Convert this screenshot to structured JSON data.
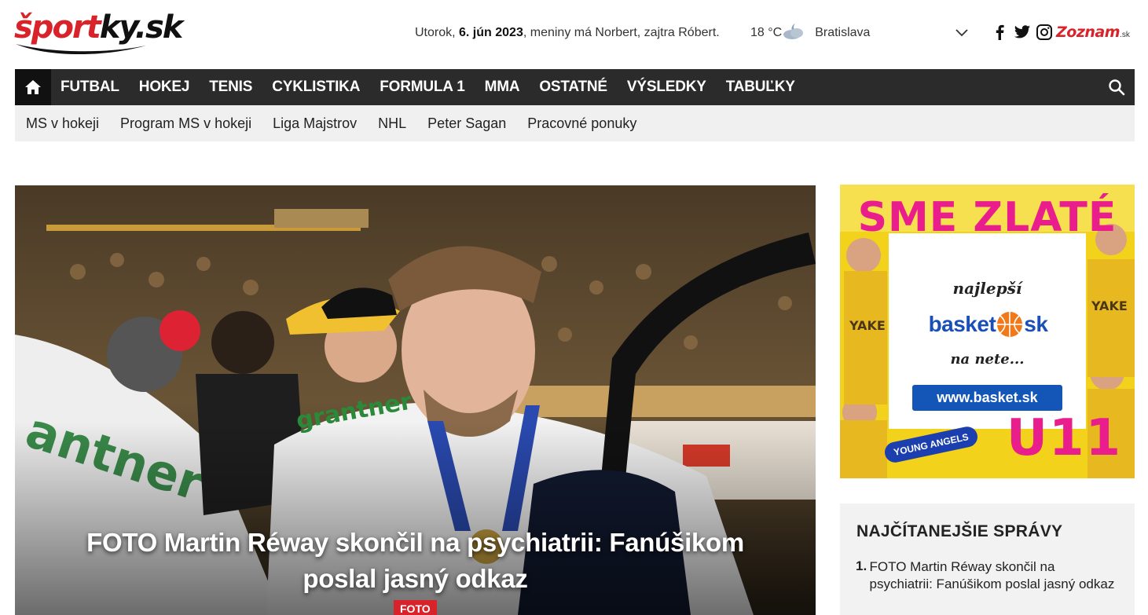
{
  "header": {
    "logo_text_red": "šport",
    "logo_text_black": "ky",
    "logo_text_suffix": ".sk",
    "date_prefix": "Utorok, ",
    "date_bold": "6. jún 2023",
    "date_suffix": ", meniny má Norbert, zajtra Róbert.",
    "weather_temp": "18 °C",
    "weather_icon": "partly-cloudy-night-icon",
    "weather_city": "Bratislava",
    "social_icons": [
      "facebook-icon",
      "twitter-icon",
      "instagram-icon"
    ],
    "partner_logo": "Zoznam",
    "partner_logo_suffix": ".sk"
  },
  "nav": {
    "home_icon": "home-icon",
    "items": [
      {
        "label": "FUTBAL"
      },
      {
        "label": "HOKEJ"
      },
      {
        "label": "TENIS"
      },
      {
        "label": "CYKLISTIKA"
      },
      {
        "label": "FORMULA 1"
      },
      {
        "label": "MMA"
      },
      {
        "label": "OSTATNÉ"
      },
      {
        "label": "VÝSLEDKY"
      },
      {
        "label": "TABUĽKY"
      }
    ],
    "search_icon": "search-icon"
  },
  "subnav": {
    "items": [
      {
        "label": "MS v hokeji"
      },
      {
        "label": "Program MS v hokeji"
      },
      {
        "label": "Liga Majstrov"
      },
      {
        "label": "NHL"
      },
      {
        "label": "Peter Sagan"
      },
      {
        "label": "Pracovné ponuky"
      }
    ]
  },
  "hero": {
    "title": "FOTO Martin Réway skončil na psychiatrii: Fanúšikom poslal jasný odkaz",
    "badge": "FOTO",
    "jersey_text": "grantner"
  },
  "ad": {
    "headline": "SME ZLATÉ",
    "najlepsi": "najlepší",
    "logo_left": "basket",
    "logo_right": "sk",
    "na_nete": "na nete...",
    "url": "www.basket.sk",
    "team_badge": "YOUNG ANGELS",
    "category": "U11",
    "colors": {
      "pink": "#e91e8c",
      "blue": "#1456b8",
      "yellow": "#f2d21a"
    }
  },
  "most_read": {
    "title": "NAJČÍTANEJŠIE SPRÁVY",
    "items": [
      {
        "num": "1.",
        "text": "FOTO Martin Réway skončil na psychiatrii: Fanúšikom poslal jasný odkaz"
      }
    ]
  },
  "colors": {
    "brand_red": "#d8232a",
    "nav_bg": "#2b2b2b",
    "subnav_bg": "#f0f0f0"
  }
}
